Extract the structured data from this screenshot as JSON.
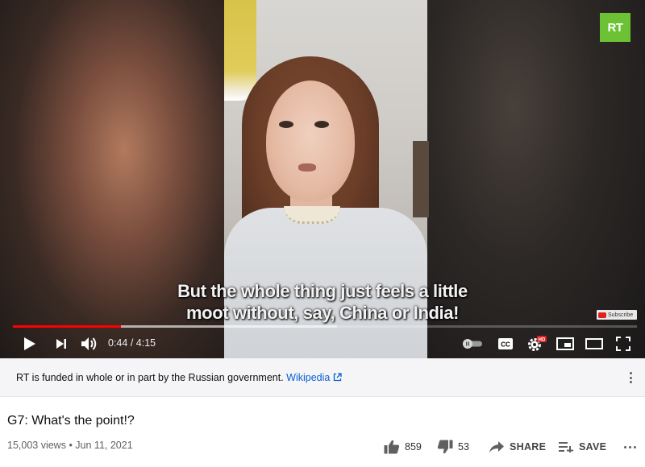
{
  "channel": {
    "logo_text": "RT",
    "brand_color": "#6cc234"
  },
  "video": {
    "captions": [
      "But the whole thing just feels a little",
      "moot without, say, China or India!"
    ],
    "watermark_label": "Subscribe",
    "played_fraction": 0.173,
    "buffered_fraction": 0.52,
    "time_current": "0:44",
    "time_separator": " / ",
    "time_total": "4:15",
    "progress_color": "#ff0000"
  },
  "controls": {
    "play_icon": "play-icon",
    "next_icon": "next-icon",
    "volume_icon": "volume-icon",
    "autoplay_icon": "autoplay-toggle-icon",
    "cc_label": "CC",
    "settings_icon": "gear-icon",
    "hd_badge": "HD",
    "miniplayer_icon": "miniplayer-icon",
    "theater_icon": "theater-mode-icon",
    "fullscreen_icon": "fullscreen-icon"
  },
  "notice": {
    "text": "RT is funded in whole or in part by the Russian government.",
    "link_text": "Wikipedia",
    "link_color": "#065fd4"
  },
  "info": {
    "title": "G7: What's the point!?",
    "views": "15,003 views",
    "separator": " • ",
    "date": "Jun 11, 2021"
  },
  "actions": {
    "likes": "859",
    "dislikes": "53",
    "share_label": "SHARE",
    "save_label": "SAVE"
  }
}
